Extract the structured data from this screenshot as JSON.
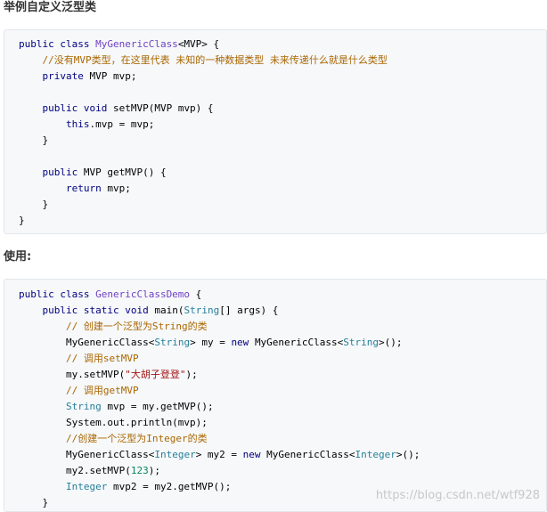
{
  "section1": {
    "heading": "举例自定义泛型类",
    "lines": [
      [
        {
          "t": "public class ",
          "c": "kw"
        },
        {
          "t": "MyGenericClass",
          "c": "cls"
        },
        {
          "t": "<MVP> {",
          "c": ""
        }
      ],
      [
        {
          "t": "    //没有MVP类型，在这里代表 未知的一种数据类型 未来传递什么就是什么类型",
          "c": "cmt"
        }
      ],
      [
        {
          "t": "    private ",
          "c": "kw"
        },
        {
          "t": "MVP mvp;",
          "c": ""
        }
      ],
      [
        {
          "t": "",
          "c": ""
        }
      ],
      [
        {
          "t": "    public void ",
          "c": "kw"
        },
        {
          "t": "setMVP(MVP mvp) {",
          "c": ""
        }
      ],
      [
        {
          "t": "        this",
          "c": "kw"
        },
        {
          "t": ".mvp = mvp;",
          "c": ""
        }
      ],
      [
        {
          "t": "    }",
          "c": ""
        }
      ],
      [
        {
          "t": "",
          "c": ""
        }
      ],
      [
        {
          "t": "    public ",
          "c": "kw"
        },
        {
          "t": "MVP getMVP() {",
          "c": ""
        }
      ],
      [
        {
          "t": "        return ",
          "c": "kw"
        },
        {
          "t": "mvp;",
          "c": ""
        }
      ],
      [
        {
          "t": "    }",
          "c": ""
        }
      ],
      [
        {
          "t": "}",
          "c": ""
        }
      ]
    ]
  },
  "section2": {
    "heading": "使用:",
    "lines": [
      [
        {
          "t": "public class ",
          "c": "kw"
        },
        {
          "t": "GenericClassDemo",
          "c": "cls"
        },
        {
          "t": " {",
          "c": ""
        }
      ],
      [
        {
          "t": "    public static void ",
          "c": "kw"
        },
        {
          "t": "main(",
          "c": ""
        },
        {
          "t": "String",
          "c": "type"
        },
        {
          "t": "[] args) {",
          "c": ""
        }
      ],
      [
        {
          "t": "        // 创建一个泛型为String的类",
          "c": "cmt"
        }
      ],
      [
        {
          "t": "        MyGenericClass<",
          "c": ""
        },
        {
          "t": "String",
          "c": "type"
        },
        {
          "t": "> my = ",
          "c": ""
        },
        {
          "t": "new ",
          "c": "kw"
        },
        {
          "t": "MyGenericClass<",
          "c": ""
        },
        {
          "t": "String",
          "c": "type"
        },
        {
          "t": ">();",
          "c": ""
        }
      ],
      [
        {
          "t": "        // 调用setMVP",
          "c": "cmt"
        }
      ],
      [
        {
          "t": "        my.setMVP(",
          "c": ""
        },
        {
          "t": "\"大胡子登登\"",
          "c": "str"
        },
        {
          "t": ");",
          "c": ""
        }
      ],
      [
        {
          "t": "        // 调用getMVP",
          "c": "cmt"
        }
      ],
      [
        {
          "t": "        ",
          "c": ""
        },
        {
          "t": "String",
          "c": "type"
        },
        {
          "t": " mvp = my.getMVP();",
          "c": ""
        }
      ],
      [
        {
          "t": "        System.out.println(mvp);",
          "c": ""
        }
      ],
      [
        {
          "t": "        //创建一个泛型为Integer的类",
          "c": "cmt"
        }
      ],
      [
        {
          "t": "        MyGenericClass<",
          "c": ""
        },
        {
          "t": "Integer",
          "c": "type"
        },
        {
          "t": "> my2 = ",
          "c": ""
        },
        {
          "t": "new ",
          "c": "kw"
        },
        {
          "t": "MyGenericClass<",
          "c": ""
        },
        {
          "t": "Integer",
          "c": "type"
        },
        {
          "t": ">();",
          "c": ""
        }
      ],
      [
        {
          "t": "        my2.setMVP(",
          "c": ""
        },
        {
          "t": "123",
          "c": "num"
        },
        {
          "t": ");",
          "c": ""
        }
      ],
      [
        {
          "t": "        ",
          "c": ""
        },
        {
          "t": "Integer",
          "c": "type"
        },
        {
          "t": " mvp2 = my2.getMVP();",
          "c": ""
        }
      ],
      [
        {
          "t": "    }",
          "c": ""
        }
      ]
    ]
  },
  "watermark": "https://blog.csdn.net/wtf928"
}
